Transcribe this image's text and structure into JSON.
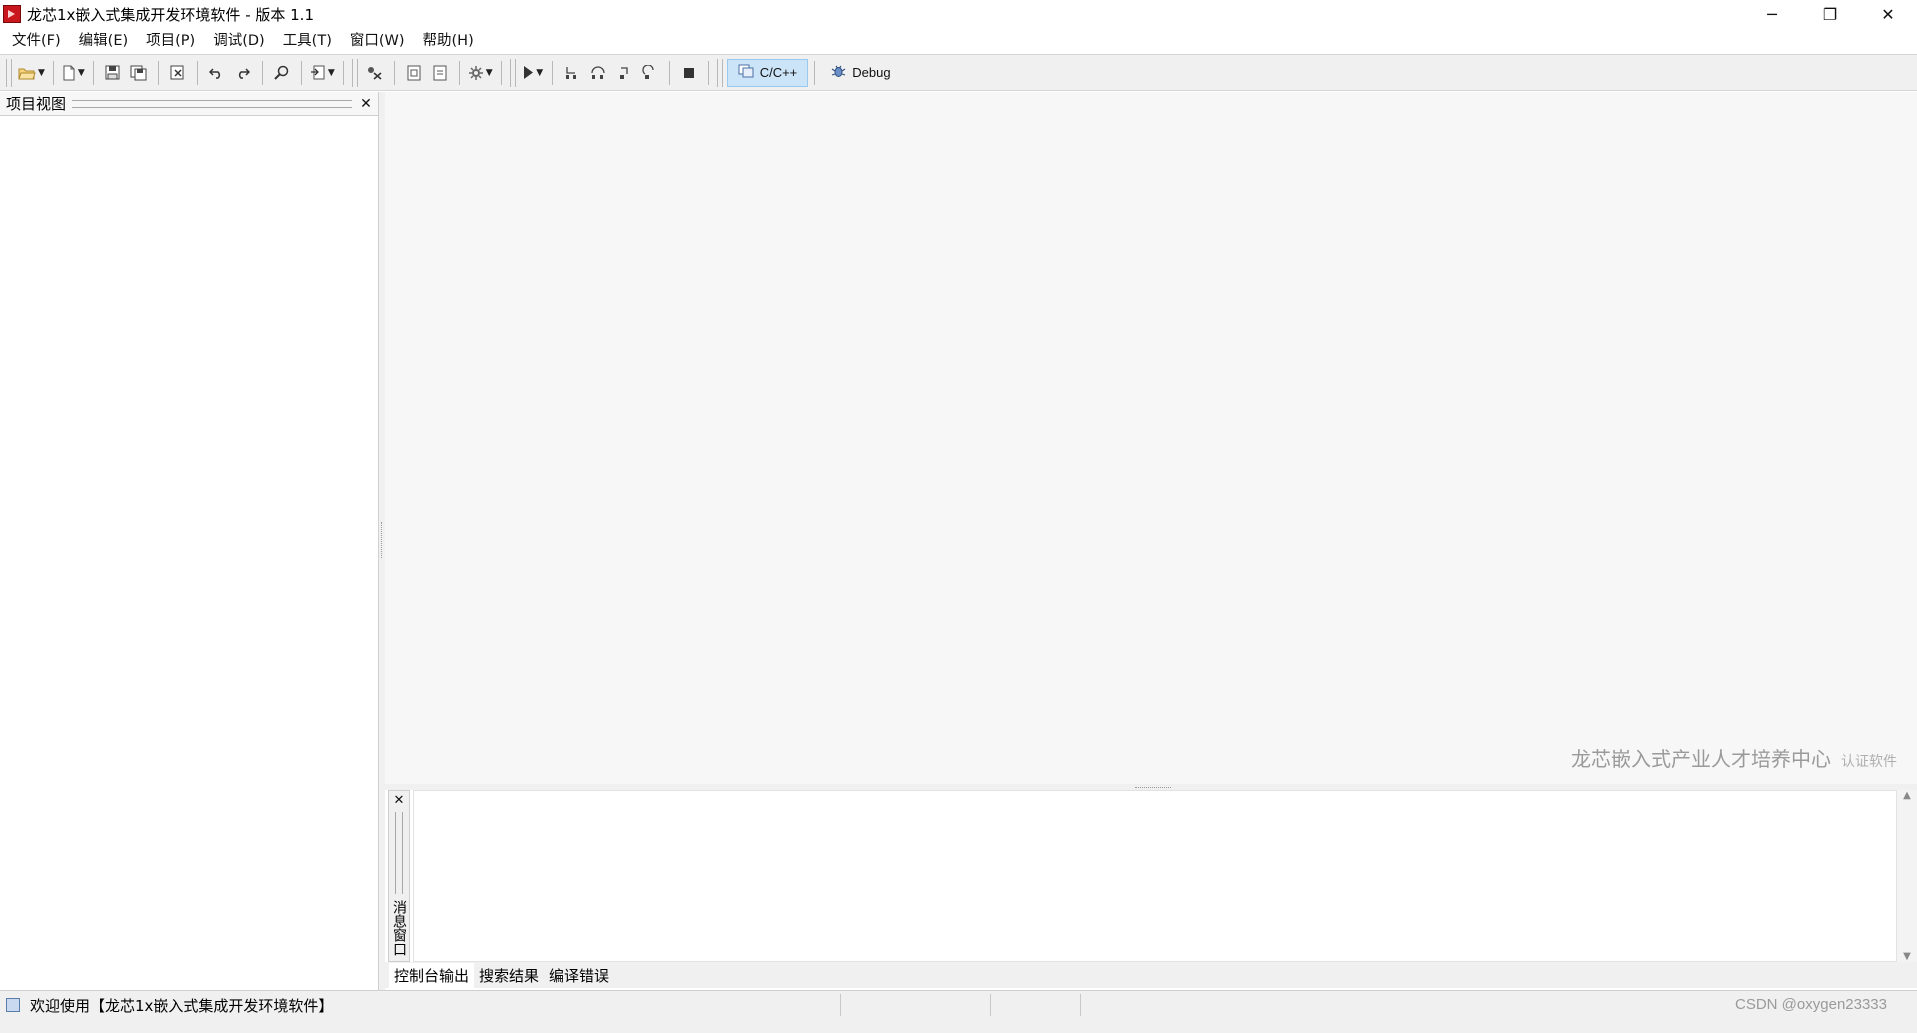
{
  "window": {
    "title": "龙芯1x嵌入式集成开发环境软件 - 版本 1.1",
    "controls": {
      "minimize": "─",
      "restore": "❐",
      "close": "✕"
    }
  },
  "menu": [
    {
      "label": "文件(F)"
    },
    {
      "label": "编辑(E)"
    },
    {
      "label": "项目(P)"
    },
    {
      "label": "调试(D)"
    },
    {
      "label": "工具(T)"
    },
    {
      "label": "窗口(W)"
    },
    {
      "label": "帮助(H)"
    }
  ],
  "toolbar": {
    "icons": [
      "open-folder-icon",
      "new-file-icon",
      "save-icon",
      "save-all-icon",
      "close-file-icon",
      "undo-icon",
      "redo-icon",
      "find-icon",
      "insert-icon",
      "tools-icon",
      "copy-icon",
      "paste-icon",
      "settings-icon",
      "run-icon",
      "step-into-icon",
      "step-over-icon",
      "step-out-icon",
      "step-return-icon",
      "stop-icon"
    ],
    "mode_cpp_label": "C/C++",
    "mode_debug_label": "Debug"
  },
  "project_panel": {
    "title": "项目视图",
    "close": "✕"
  },
  "editor": {
    "watermark_main": "龙芯嵌入式产业人才培养中心",
    "watermark_sub": "认证软件"
  },
  "output_panel": {
    "close": "✕",
    "side_title": "消息窗口",
    "tabs": [
      {
        "label": "控制台输出",
        "active": true
      },
      {
        "label": "搜索结果",
        "active": false
      },
      {
        "label": "编译错误",
        "active": false
      }
    ],
    "scroll_up": "▲",
    "scroll_down": "▼"
  },
  "statusbar": {
    "message": "欢迎使用【龙芯1x嵌入式集成开发环境软件】",
    "corner_text": "CSDN @oxygen23333"
  },
  "colors": {
    "accent_active": "#cce4f7",
    "app_icon": "#c9171e",
    "watermark": "#9a9a9a"
  }
}
